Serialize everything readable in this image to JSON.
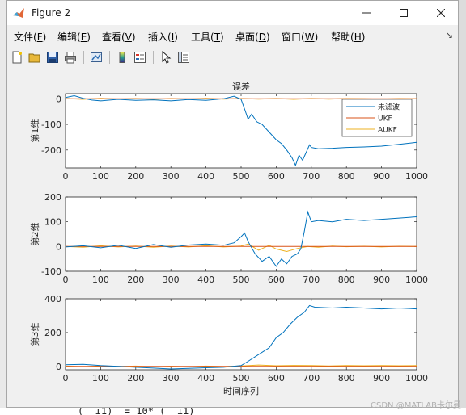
{
  "window": {
    "title": "Figure 2"
  },
  "menu": [
    {
      "text": "文件(",
      "key": "F",
      "close": ")"
    },
    {
      "text": "编辑(",
      "key": "E",
      "close": ")"
    },
    {
      "text": "查看(",
      "key": "V",
      "close": ")"
    },
    {
      "text": "插入(",
      "key": "I",
      "close": ")"
    },
    {
      "text": "工具(",
      "key": "T",
      "close": ")"
    },
    {
      "text": "桌面(",
      "key": "D",
      "close": ")"
    },
    {
      "text": "窗口(",
      "key": "W",
      "close": ")"
    },
    {
      "text": "帮助(",
      "key": "H",
      "close": ")"
    }
  ],
  "toolbar_icons": [
    "new-figure-icon",
    "open-file-icon",
    "save-icon",
    "print-icon",
    "link-plot-icon",
    "insert-colorbar-icon",
    "insert-legend-icon",
    "edit-plot-icon",
    "property-inspector-icon"
  ],
  "background": {
    "code_snippet": "(  i1)  = 10* (  i1)",
    "watermark": "CSDN @MATLAB卡尔曼"
  },
  "chart_data": [
    {
      "type": "line",
      "title": "误差",
      "xlabel": "",
      "ylabel": "第1维",
      "xlim": [
        0,
        1000
      ],
      "ylim": [
        -270,
        20
      ],
      "xticks": [
        0,
        100,
        200,
        300,
        400,
        500,
        600,
        700,
        800,
        900,
        1000
      ],
      "yticks": [
        -200,
        -100,
        0
      ],
      "legend": {
        "position": "top-right",
        "entries": [
          "未滤波",
          "UKF",
          "AUKF"
        ]
      },
      "series": [
        {
          "name": "未滤波",
          "color": "#0072bd",
          "x": [
            0,
            25,
            50,
            75,
            100,
            150,
            200,
            250,
            300,
            350,
            400,
            450,
            480,
            500,
            510,
            520,
            530,
            545,
            560,
            580,
            600,
            615,
            630,
            645,
            655,
            665,
            675,
            685,
            695,
            700,
            720,
            760,
            800,
            850,
            900,
            950,
            1000
          ],
          "y": [
            5,
            12,
            2,
            -5,
            -8,
            -2,
            -6,
            -4,
            -8,
            -3,
            -6,
            0,
            10,
            -2,
            -40,
            -80,
            -60,
            -90,
            -100,
            -130,
            -160,
            -175,
            -200,
            -230,
            -260,
            -220,
            -240,
            -210,
            -180,
            -190,
            -195,
            -193,
            -190,
            -188,
            -185,
            -178,
            -170
          ]
        },
        {
          "name": "UKF",
          "color": "#d95319",
          "x": [
            0,
            100,
            200,
            300,
            400,
            500,
            600,
            700,
            800,
            900,
            1000
          ],
          "y": [
            0,
            0,
            0,
            0,
            0,
            0,
            0,
            0,
            0,
            0,
            0
          ]
        },
        {
          "name": "AUKF",
          "color": "#edb120",
          "x": [
            0,
            50,
            100,
            150,
            200,
            250,
            300,
            350,
            400,
            450,
            500,
            550,
            600,
            650,
            700,
            750,
            800,
            850,
            900,
            950,
            1000
          ],
          "y": [
            1,
            -2,
            2,
            -1,
            1,
            -2,
            1,
            -1,
            2,
            -1,
            1,
            -1,
            1,
            -2,
            1,
            -1,
            1,
            0,
            -1,
            1,
            0
          ]
        }
      ]
    },
    {
      "type": "line",
      "title": "",
      "xlabel": "",
      "ylabel": "第2维",
      "xlim": [
        0,
        1000
      ],
      "ylim": [
        -100,
        200
      ],
      "xticks": [
        0,
        100,
        200,
        300,
        400,
        500,
        600,
        700,
        800,
        900,
        1000
      ],
      "yticks": [
        -100,
        0,
        100,
        200
      ],
      "series": [
        {
          "name": "未滤波",
          "color": "#0072bd",
          "x": [
            0,
            50,
            100,
            150,
            200,
            250,
            300,
            350,
            400,
            450,
            480,
            500,
            510,
            520,
            540,
            560,
            580,
            600,
            615,
            630,
            645,
            660,
            670,
            680,
            690,
            700,
            720,
            760,
            800,
            850,
            900,
            950,
            1000
          ],
          "y": [
            -2,
            3,
            -5,
            5,
            -8,
            8,
            -3,
            6,
            10,
            5,
            15,
            40,
            55,
            20,
            -30,
            -60,
            -40,
            -80,
            -50,
            -70,
            -40,
            -30,
            -10,
            60,
            140,
            100,
            105,
            100,
            110,
            105,
            110,
            115,
            120
          ]
        },
        {
          "name": "UKF",
          "color": "#d95319",
          "x": [
            0,
            100,
            200,
            300,
            400,
            500,
            600,
            700,
            800,
            900,
            1000
          ],
          "y": [
            0,
            0,
            0,
            0,
            0,
            0,
            0,
            0,
            0,
            0,
            0
          ]
        },
        {
          "name": "AUKF",
          "color": "#edb120",
          "x": [
            0,
            50,
            100,
            150,
            200,
            250,
            300,
            350,
            400,
            450,
            500,
            520,
            550,
            580,
            600,
            630,
            660,
            690,
            720,
            760,
            800,
            850,
            900,
            950,
            1000
          ],
          "y": [
            0,
            -3,
            3,
            -2,
            2,
            -3,
            2,
            -2,
            3,
            -2,
            2,
            10,
            -15,
            5,
            -10,
            -20,
            -8,
            0,
            -3,
            2,
            -1,
            1,
            -2,
            1,
            0
          ]
        }
      ]
    },
    {
      "type": "line",
      "title": "",
      "xlabel": "时间序列",
      "ylabel": "第3维",
      "xlim": [
        0,
        1000
      ],
      "ylim": [
        -20,
        400
      ],
      "xticks": [
        0,
        100,
        200,
        300,
        400,
        500,
        600,
        700,
        800,
        900,
        1000
      ],
      "yticks": [
        0,
        200,
        400
      ],
      "series": [
        {
          "name": "未滤波",
          "color": "#0072bd",
          "x": [
            0,
            50,
            100,
            150,
            200,
            250,
            300,
            350,
            400,
            450,
            500,
            520,
            550,
            580,
            600,
            620,
            640,
            660,
            680,
            695,
            710,
            760,
            800,
            850,
            900,
            950,
            1000
          ],
          "y": [
            10,
            12,
            5,
            0,
            -5,
            -10,
            -15,
            -12,
            -8,
            -5,
            5,
            30,
            70,
            110,
            170,
            200,
            250,
            290,
            320,
            360,
            350,
            345,
            350,
            345,
            340,
            345,
            340
          ]
        },
        {
          "name": "UKF",
          "color": "#d95319",
          "x": [
            0,
            100,
            200,
            300,
            400,
            500,
            600,
            700,
            800,
            900,
            1000
          ],
          "y": [
            0,
            0,
            0,
            0,
            0,
            0,
            0,
            0,
            0,
            0,
            0
          ]
        },
        {
          "name": "AUKF",
          "color": "#edb120",
          "x": [
            0,
            50,
            100,
            150,
            200,
            250,
            300,
            350,
            400,
            450,
            500,
            550,
            600,
            650,
            700,
            750,
            800,
            850,
            900,
            950,
            1000
          ],
          "y": [
            2,
            -2,
            3,
            -1,
            2,
            -3,
            1,
            -2,
            2,
            -1,
            3,
            8,
            4,
            6,
            5,
            3,
            5,
            4,
            5,
            4,
            5
          ]
        }
      ]
    }
  ]
}
